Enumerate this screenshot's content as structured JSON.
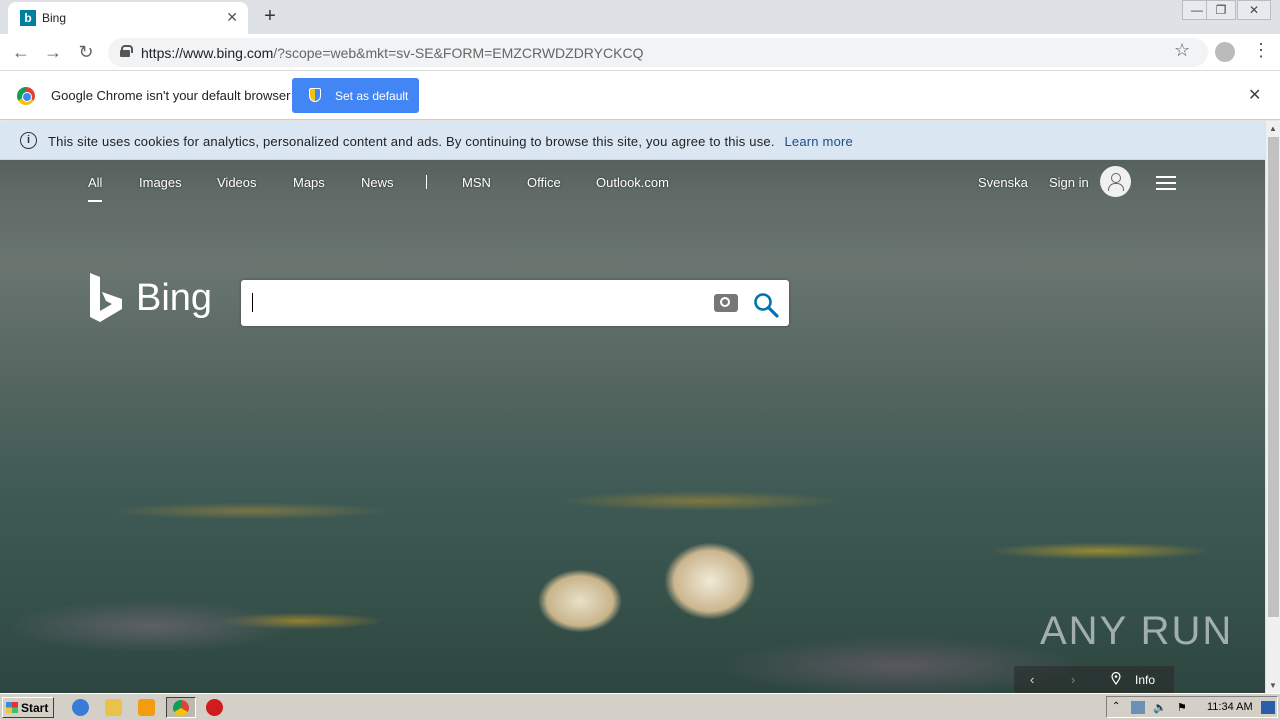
{
  "browser": {
    "tab_title": "Bing",
    "tab_favicon": "b",
    "url_host": "https://www.bing.com",
    "url_rest": "/?scope=web&mkt=sv-SE&FORM=EMZCRWDZDRYCKCQ"
  },
  "default_bar": {
    "message": "Google Chrome isn't your default browser",
    "button_label": "Set as default"
  },
  "cookie_bar": {
    "message": "This site uses cookies for analytics, personalized content and ads. By continuing to browse this site, you agree to this use.",
    "link_label": "Learn more"
  },
  "bing_nav": {
    "items": [
      "All",
      "Images",
      "Videos",
      "Maps",
      "News",
      "MSN",
      "Office",
      "Outlook.com"
    ],
    "language": "Svenska",
    "sign_in": "Sign in"
  },
  "search": {
    "logo_text": "Bing",
    "value": ""
  },
  "carousel": {
    "prev": "‹",
    "next": "›",
    "info_label": "Info"
  },
  "watermark": "ANY RUN",
  "taskbar": {
    "start_label": "Start",
    "clock": "11:34 AM"
  },
  "colors": {
    "accent_blue": "#4285f4",
    "bing_teal": "#00809d",
    "link_blue": "#1a4f8c"
  }
}
